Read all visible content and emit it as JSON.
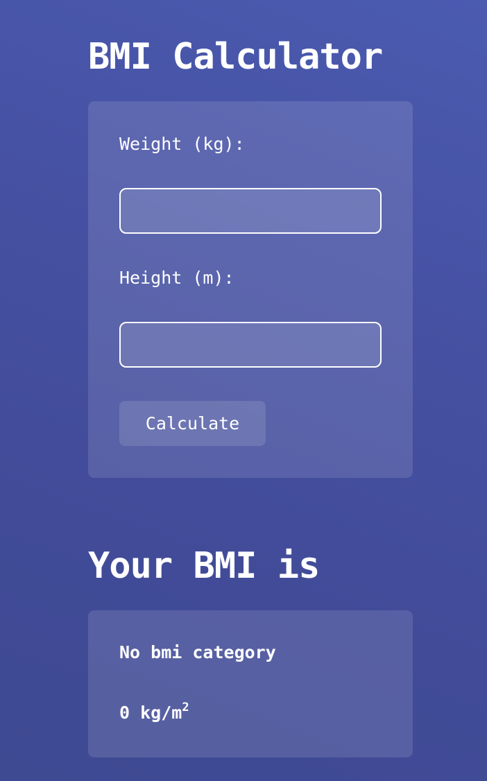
{
  "header": {
    "title": "BMI Calculator"
  },
  "form": {
    "weight_label": "Weight (kg):",
    "weight_value": "",
    "height_label": "Height (m):",
    "height_value": "",
    "calculate_label": "Calculate"
  },
  "result": {
    "heading": "Your BMI is",
    "category": "No bmi category",
    "bmi_value": "0",
    "unit_base": "kg/m",
    "unit_exponent": "2"
  }
}
